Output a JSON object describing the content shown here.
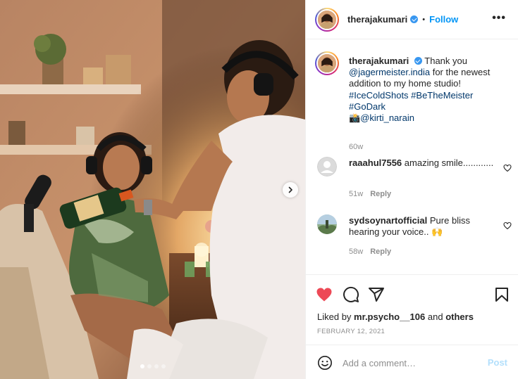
{
  "post": {
    "username": "therajakumari",
    "follow_label": "Follow",
    "separator": "•",
    "more_label": "•••",
    "image_count": 4,
    "image_index": 1
  },
  "caption": {
    "username": "therajakumari",
    "text_1": "Thank you",
    "mention": "@jagermeister.india",
    "text_2": "for the newest addition to my home studio!",
    "hashtags": "#IceColdShots #BeTheMeister #GoDark",
    "camera_emoji": "📸",
    "credit": "@kirti_narain",
    "age": "60w"
  },
  "comments": [
    {
      "username": "raaahul7556",
      "text": "amazing smile............",
      "age": "51w",
      "reply_label": "Reply"
    },
    {
      "username": "sydsoynartofficial",
      "text": "Pure bliss hearing your voice..",
      "emoji": "🙌",
      "age": "58w",
      "reply_label": "Reply"
    }
  ],
  "actions": {
    "liked_prefix": "Liked by",
    "liked_user": "mr.psycho__106",
    "liked_and": "and",
    "liked_others": "others",
    "date": "FEBRUARY 12, 2021"
  },
  "add_comment": {
    "placeholder": "Add a comment…",
    "post_label": "Post"
  },
  "colors": {
    "follow_blue": "#0095f6",
    "like_red": "#ed4956",
    "link_blue": "#00376b",
    "meta_gray": "#8e8e8e",
    "post_disabled": "#b2dffc"
  }
}
